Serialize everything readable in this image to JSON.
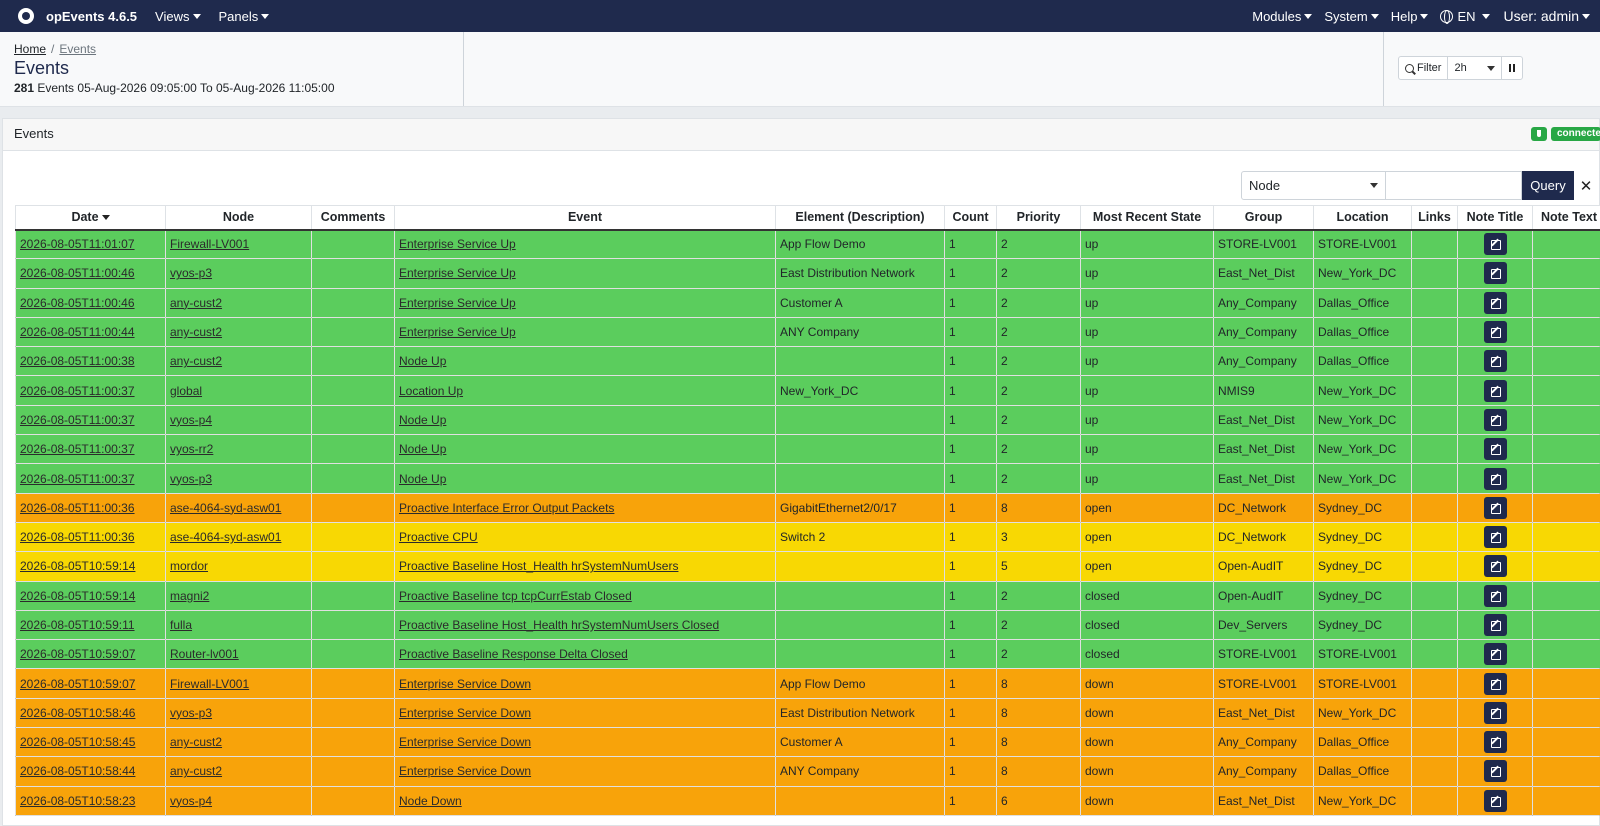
{
  "navbar": {
    "brand": "opEvents 4.6.5",
    "menus": [
      "Views",
      "Panels"
    ],
    "right_menus": [
      "Modules",
      "System",
      "Help"
    ],
    "language": "EN",
    "user": "User: admin"
  },
  "header": {
    "breadcrumb_home": "Home",
    "breadcrumb_current": "Events",
    "title": "Events",
    "count": "281",
    "summary_text": "Events 05-Aug-2026 09:05:00 To 05-Aug-2026 11:05:00",
    "filter_label": "Filter",
    "range_value": "2h"
  },
  "card": {
    "title": "Events",
    "status": "connected",
    "query_field": "Node",
    "query_button": "Query",
    "clear_label": "✕"
  },
  "colors": {
    "up": "#5bcd5d",
    "open_high": "#f8a30a",
    "open_med": "#f8d803",
    "nav": "#1f2a4d"
  },
  "table": {
    "columns": [
      "Date",
      "Node",
      "Comments",
      "Event",
      "Element (Description)",
      "Count",
      "Priority",
      "Most Recent State",
      "Group",
      "Location",
      "Links",
      "Note Title",
      "Note Text"
    ],
    "rows": [
      {
        "date": "2026-08-05T11:01:07",
        "node": "Firewall-LV001",
        "event": "Enterprise Service Up",
        "element": "App Flow Demo",
        "count": "1",
        "priority": "2",
        "state": "up",
        "group": "STORE-LV001",
        "location": "STORE-LV001",
        "color": "#5bcd5d"
      },
      {
        "date": "2026-08-05T11:00:46",
        "node": "vyos-p3",
        "event": "Enterprise Service Up",
        "element": "East Distribution Network",
        "count": "1",
        "priority": "2",
        "state": "up",
        "group": "East_Net_Dist",
        "location": "New_York_DC",
        "color": "#5bcd5d"
      },
      {
        "date": "2026-08-05T11:00:46",
        "node": "any-cust2",
        "event": "Enterprise Service Up",
        "element": "Customer A",
        "count": "1",
        "priority": "2",
        "state": "up",
        "group": "Any_Company",
        "location": "Dallas_Office",
        "color": "#5bcd5d"
      },
      {
        "date": "2026-08-05T11:00:44",
        "node": "any-cust2",
        "event": "Enterprise Service Up",
        "element": "ANY Company",
        "count": "1",
        "priority": "2",
        "state": "up",
        "group": "Any_Company",
        "location": "Dallas_Office",
        "color": "#5bcd5d"
      },
      {
        "date": "2026-08-05T11:00:38",
        "node": "any-cust2",
        "event": "Node Up",
        "element": "",
        "count": "1",
        "priority": "2",
        "state": "up",
        "group": "Any_Company",
        "location": "Dallas_Office",
        "color": "#5bcd5d"
      },
      {
        "date": "2026-08-05T11:00:37",
        "node": "global",
        "event": "Location Up",
        "element": "New_York_DC",
        "count": "1",
        "priority": "2",
        "state": "up",
        "group": "NMIS9",
        "location": "New_York_DC",
        "color": "#5bcd5d"
      },
      {
        "date": "2026-08-05T11:00:37",
        "node": "vyos-p4",
        "event": "Node Up",
        "element": "",
        "count": "1",
        "priority": "2",
        "state": "up",
        "group": "East_Net_Dist",
        "location": "New_York_DC",
        "color": "#5bcd5d"
      },
      {
        "date": "2026-08-05T11:00:37",
        "node": "vyos-rr2",
        "event": "Node Up",
        "element": "",
        "count": "1",
        "priority": "2",
        "state": "up",
        "group": "East_Net_Dist",
        "location": "New_York_DC",
        "color": "#5bcd5d"
      },
      {
        "date": "2026-08-05T11:00:37",
        "node": "vyos-p3",
        "event": "Node Up",
        "element": "",
        "count": "1",
        "priority": "2",
        "state": "up",
        "group": "East_Net_Dist",
        "location": "New_York_DC",
        "color": "#5bcd5d"
      },
      {
        "date": "2026-08-05T11:00:36",
        "node": "ase-4064-syd-asw01",
        "event": "Proactive Interface Error Output Packets",
        "element": "GigabitEthernet2/0/17",
        "count": "1",
        "priority": "8",
        "state": "open",
        "group": "DC_Network",
        "location": "Sydney_DC",
        "color": "#f8a30a"
      },
      {
        "date": "2026-08-05T11:00:36",
        "node": "ase-4064-syd-asw01",
        "event": "Proactive CPU",
        "element": "Switch 2",
        "count": "1",
        "priority": "3",
        "state": "open",
        "group": "DC_Network",
        "location": "Sydney_DC",
        "color": "#f8d803"
      },
      {
        "date": "2026-08-05T10:59:14",
        "node": "mordor",
        "event": "Proactive Baseline Host_Health hrSystemNumUsers",
        "element": "",
        "count": "1",
        "priority": "5",
        "state": "open",
        "group": "Open-AudIT",
        "location": "Sydney_DC",
        "color": "#f8d803"
      },
      {
        "date": "2026-08-05T10:59:14",
        "node": "magni2",
        "event": "Proactive Baseline tcp tcpCurrEstab Closed",
        "element": "",
        "count": "1",
        "priority": "2",
        "state": "closed",
        "group": "Open-AudIT",
        "location": "Sydney_DC",
        "color": "#5bcd5d"
      },
      {
        "date": "2026-08-05T10:59:11",
        "node": "fulla",
        "event": "Proactive Baseline Host_Health hrSystemNumUsers Closed",
        "element": "",
        "count": "1",
        "priority": "2",
        "state": "closed",
        "group": "Dev_Servers",
        "location": "Sydney_DC",
        "color": "#5bcd5d"
      },
      {
        "date": "2026-08-05T10:59:07",
        "node": "Router-lv001",
        "event": "Proactive Baseline Response Delta Closed",
        "element": "",
        "count": "1",
        "priority": "2",
        "state": "closed",
        "group": "STORE-LV001",
        "location": "STORE-LV001",
        "color": "#5bcd5d"
      },
      {
        "date": "2026-08-05T10:59:07",
        "node": "Firewall-LV001",
        "event": "Enterprise Service Down",
        "element": "App Flow Demo",
        "count": "1",
        "priority": "8",
        "state": "down",
        "group": "STORE-LV001",
        "location": "STORE-LV001",
        "color": "#f8a30a"
      },
      {
        "date": "2026-08-05T10:58:46",
        "node": "vyos-p3",
        "event": "Enterprise Service Down",
        "element": "East Distribution Network",
        "count": "1",
        "priority": "8",
        "state": "down",
        "group": "East_Net_Dist",
        "location": "New_York_DC",
        "color": "#f8a30a"
      },
      {
        "date": "2026-08-05T10:58:45",
        "node": "any-cust2",
        "event": "Enterprise Service Down",
        "element": "Customer A",
        "count": "1",
        "priority": "8",
        "state": "down",
        "group": "Any_Company",
        "location": "Dallas_Office",
        "color": "#f8a30a"
      },
      {
        "date": "2026-08-05T10:58:44",
        "node": "any-cust2",
        "event": "Enterprise Service Down",
        "element": "ANY Company",
        "count": "1",
        "priority": "8",
        "state": "down",
        "group": "Any_Company",
        "location": "Dallas_Office",
        "color": "#f8a30a"
      },
      {
        "date": "2026-08-05T10:58:23",
        "node": "vyos-p4",
        "event": "Node Down",
        "element": "",
        "count": "1",
        "priority": "6",
        "state": "down",
        "group": "East_Net_Dist",
        "location": "New_York_DC",
        "color": "#f8a30a"
      }
    ]
  }
}
